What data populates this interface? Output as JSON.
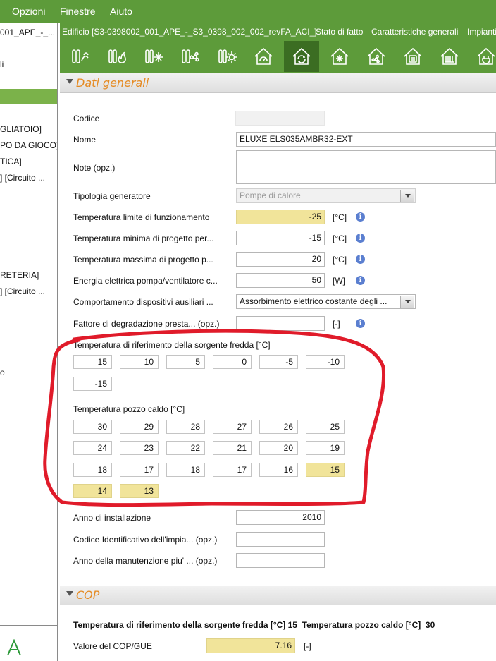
{
  "menubar": {
    "items": [
      "Opzioni",
      "Finestre",
      "Aiuto"
    ]
  },
  "left_panel": {
    "items": [
      "001_APE_-_...",
      "li",
      "GLIATOIO]",
      "PO DA GIOCO]",
      "TICA]",
      "] [Circuito ...",
      "RETERIA]",
      "] [Circuito ...",
      "o"
    ]
  },
  "breadcrumb": {
    "items": [
      "Edificio [S3-0398002_001_APE_-_S3_0398_002_002_revFA_ACI_]",
      "Stato di fatto",
      "Caratteristiche generali",
      "Impianti"
    ]
  },
  "toolbar": {
    "icons": [
      "radiator-heating-icon",
      "flame-heating-icon",
      "snowflake-cooling-icon",
      "fan-ventilation-icon",
      "sun-solar-icon",
      "house-gauge-icon",
      "heat-pump-house-icon",
      "house-snowflake-icon",
      "house-fan-icon",
      "house-hot-water-icon",
      "house-radiator-icon",
      "house-plug-icon"
    ],
    "active_index": 6
  },
  "sections": {
    "general": "Dati generali",
    "cop": "COP"
  },
  "form": {
    "codice": {
      "label": "Codice",
      "value": ""
    },
    "nome": {
      "label": "Nome",
      "value": "ELUXE ELS035AMBR32-EXT"
    },
    "note": {
      "label": "Note (opz.)",
      "value": ""
    },
    "tipologia": {
      "label": "Tipologia generatore",
      "value": "Pompe di calore"
    },
    "t_limite": {
      "label": "Temperatura limite di funzionamento",
      "value": "-25",
      "unit": "[°C]"
    },
    "t_min": {
      "label": "Temperatura minima di progetto per...",
      "value": "-15",
      "unit": "[°C]"
    },
    "t_max": {
      "label": "Temperatura massima di progetto p...",
      "value": "20",
      "unit": "[°C]"
    },
    "energia": {
      "label": "Energia elettrica pompa/ventilatore c...",
      "value": "50",
      "unit": "[W]"
    },
    "comportamento": {
      "label": "Comportamento dispositivi ausiliari ...",
      "value": "Assorbimento elettrico costante degli ..."
    },
    "fattore": {
      "label": "Fattore di degradazione presta... (opz.)",
      "value": "",
      "unit": "[-]"
    },
    "sorgente_fredda": {
      "label": "Temperatura di riferimento della sorgente fredda [°C]",
      "values": [
        "15",
        "10",
        "5",
        "0",
        "-5",
        "-10",
        "-15"
      ]
    },
    "pozzo_caldo": {
      "label": "Temperatura pozzo caldo [°C]",
      "values": [
        "30",
        "29",
        "28",
        "27",
        "26",
        "25",
        "24",
        "23",
        "22",
        "21",
        "20",
        "19",
        "18",
        "17",
        "18",
        "17",
        "16",
        "15",
        "14",
        "13"
      ],
      "highlighted": [
        17,
        18,
        19
      ]
    },
    "anno_installazione": {
      "label": "Anno di installazione",
      "value": "2010"
    },
    "codice_id": {
      "label": "Codice Identificativo dell'impia... (opz.)",
      "value": ""
    },
    "anno_manutenzione": {
      "label": "Anno della manutenzione piu' ... (opz.)",
      "value": ""
    }
  },
  "cop": {
    "summary": "Temperatura di riferimento della sorgente fredda [°C] 15  Temperatura pozzo caldo [°C]  30",
    "label": "Valore del COP/GUE",
    "value": "7.16",
    "unit": "[-]"
  },
  "annotation": {
    "color": "#e01b2a"
  }
}
